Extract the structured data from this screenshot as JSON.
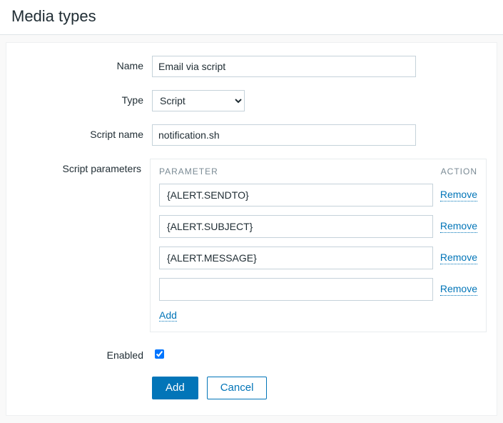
{
  "header": {
    "title": "Media types"
  },
  "form": {
    "name_label": "Name",
    "name_value": "Email via script",
    "type_label": "Type",
    "type_value": "Script",
    "scriptname_label": "Script name",
    "scriptname_value": "notification.sh",
    "params_label": "Script parameters",
    "params_header_param": "PARAMETER",
    "params_header_action": "ACTION",
    "params": [
      {
        "value": "{ALERT.SENDTO}",
        "remove": "Remove"
      },
      {
        "value": "{ALERT.SUBJECT}",
        "remove": "Remove"
      },
      {
        "value": "{ALERT.MESSAGE}",
        "remove": "Remove"
      },
      {
        "value": "",
        "remove": "Remove"
      }
    ],
    "add_param": "Add",
    "enabled_label": "Enabled",
    "enabled_checked": true,
    "buttons": {
      "add": "Add",
      "cancel": "Cancel"
    }
  }
}
